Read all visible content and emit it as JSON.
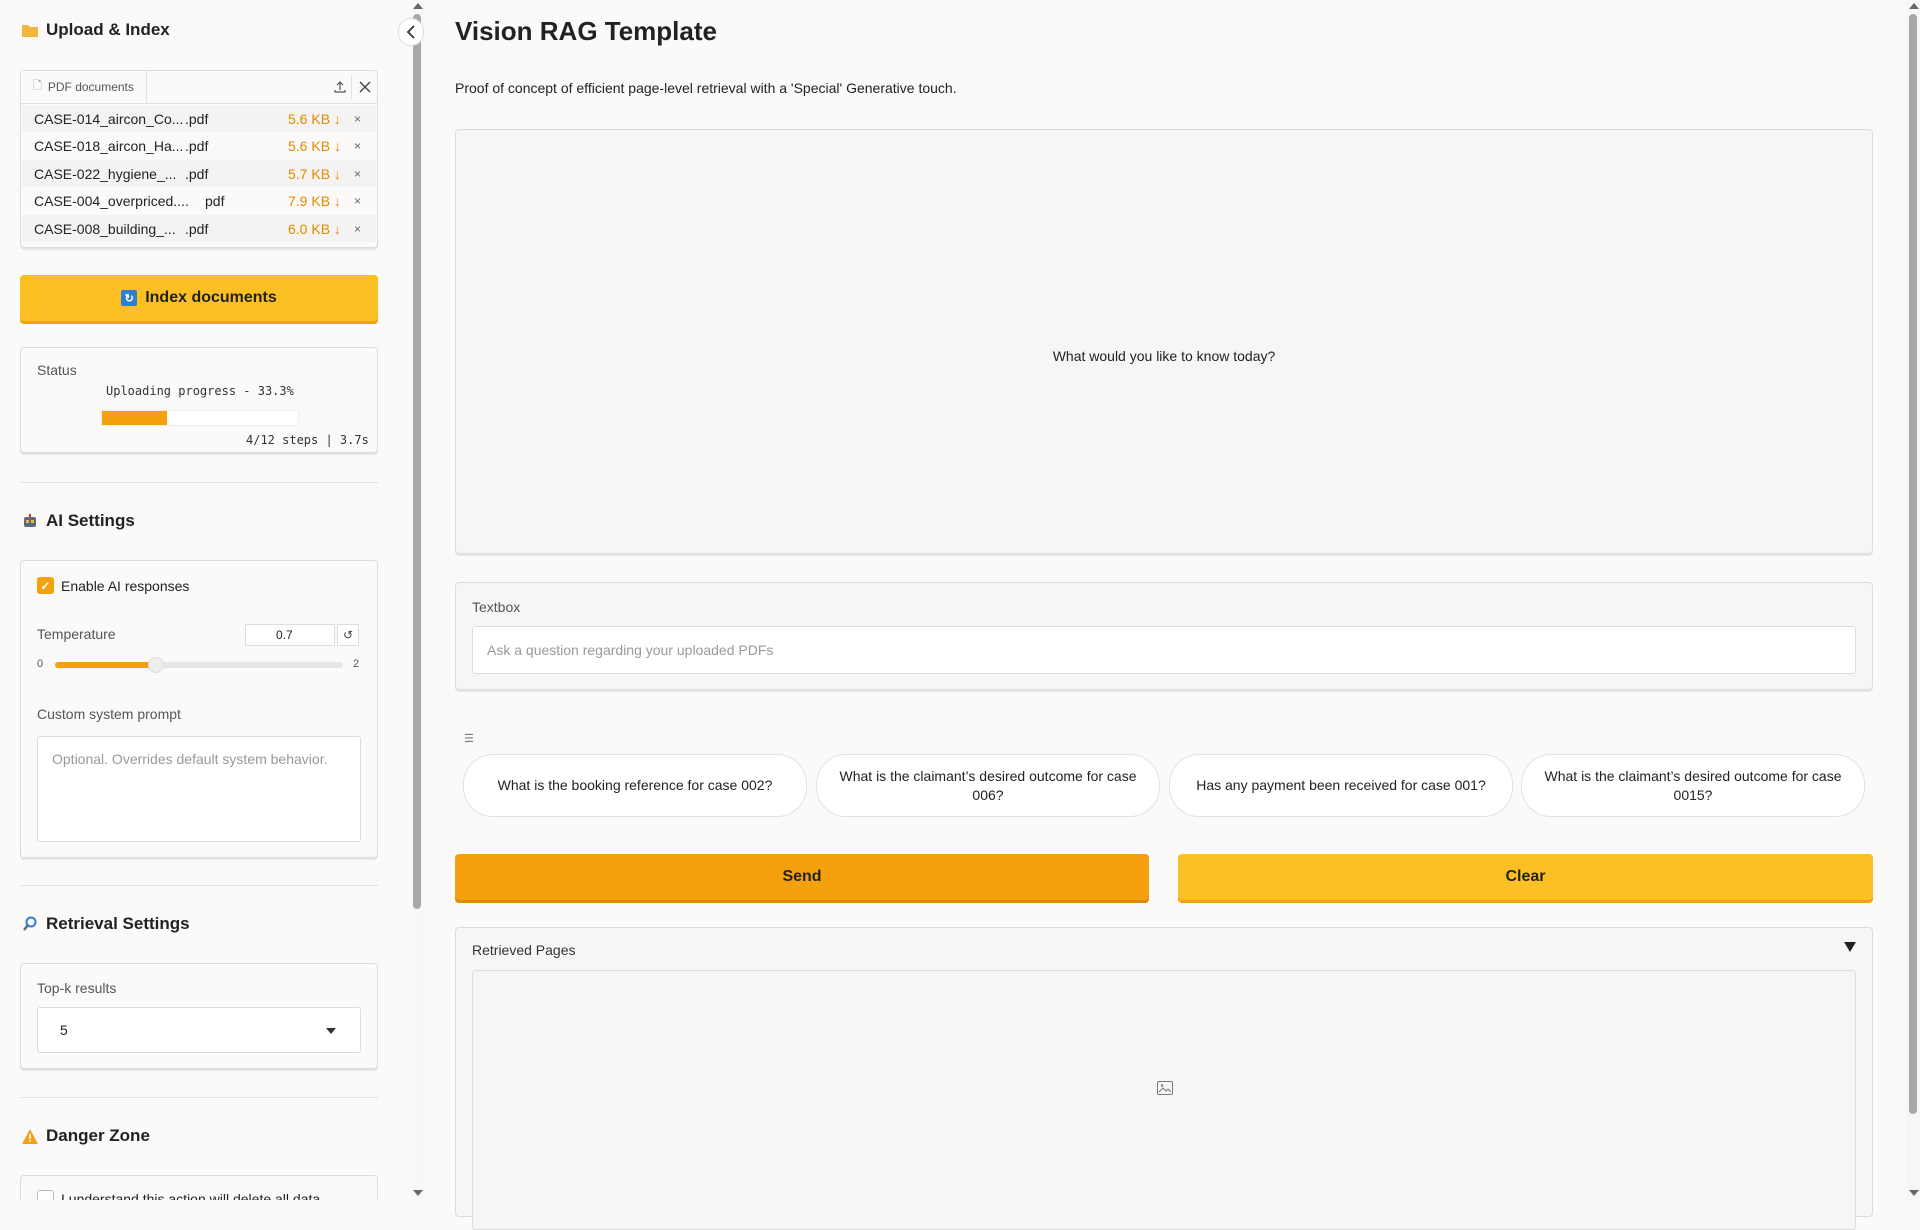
{
  "sidebar": {
    "upload": {
      "title": "Upload & Index",
      "tab_label": "PDF documents",
      "files": [
        {
          "name": "CASE-014_aircon_Co...",
          "ext": ".pdf",
          "size": "5.6 KB ↓"
        },
        {
          "name": "CASE-018_aircon_Ha...",
          "ext": ".pdf",
          "size": "5.6 KB ↓"
        },
        {
          "name": "CASE-022_hygiene_...",
          "ext": ".pdf",
          "size": "5.7 KB ↓"
        },
        {
          "name": "CASE-004_overpriced....",
          "ext": "pdf",
          "size": "7.9 KB ↓"
        },
        {
          "name": "CASE-008_building_...",
          "ext": ".pdf",
          "size": "6.0 KB ↓"
        }
      ],
      "remove_glyph": "×",
      "index_button": "Index documents"
    },
    "status": {
      "label": "Status",
      "progress_text": "Uploading progress - 33.3%",
      "progress_fraction": 0.333,
      "steps_text": "4/12 steps | 3.7s"
    },
    "ai": {
      "title": "AI Settings",
      "enable_label": "Enable AI responses",
      "enable_checked": true,
      "temperature_label": "Temperature",
      "temperature_value": "0.7",
      "temperature_min": "0",
      "temperature_max": "2",
      "temperature_fraction": 0.35,
      "prompt_label": "Custom system prompt",
      "prompt_placeholder": "Optional. Overrides default system behavior."
    },
    "retrieval": {
      "title": "Retrieval Settings",
      "topk_label": "Top-k results",
      "topk_value": "5"
    },
    "danger": {
      "title": "Danger Zone",
      "confirm_label": "I understand this action will delete all data"
    }
  },
  "main": {
    "title": "Vision RAG Template",
    "description": "Proof of concept of efficient page-level retrieval with a 'Special' Generative touch.",
    "chat_placeholder": "What would you like to know today?",
    "textbox_label": "Textbox",
    "textbox_placeholder": "Ask a question regarding your uploaded PDFs",
    "examples": [
      "What is the booking reference for case 002?",
      "What is the claimant’s desired outcome for case 006?",
      "Has any payment been received for case 001?",
      "What is the claimant’s desired outcome for case 0015?"
    ],
    "send_label": "Send",
    "clear_label": "Clear",
    "retrieved_label": "Retrieved Pages"
  },
  "colors": {
    "accent_orange": "#f5a00f",
    "accent_yellow": "#fcc025",
    "file_size": "#e08a00"
  }
}
